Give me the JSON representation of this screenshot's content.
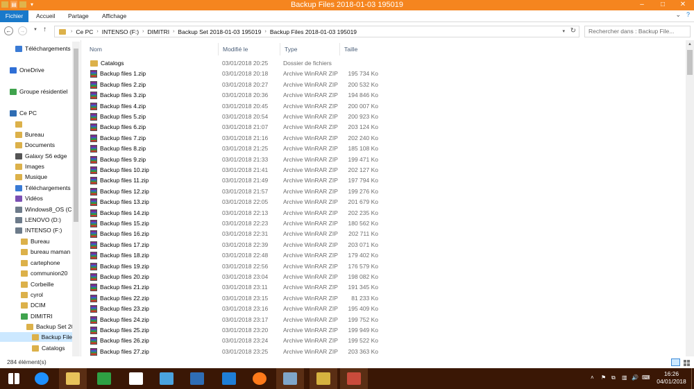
{
  "window": {
    "title": "Backup Files 2018-01-03 195019",
    "controls": {
      "minimize": "–",
      "maximize": "□",
      "close": "✕"
    }
  },
  "ribbon": {
    "tabs": [
      "Fichier",
      "Accueil",
      "Partage",
      "Affichage"
    ],
    "expand": "⌄",
    "help": "?"
  },
  "address": {
    "segments": [
      "Ce PC",
      "INTENSO (F:)",
      "DIMITRI",
      "Backup Set 2018-01-03 195019",
      "Backup Files 2018-01-03 195019"
    ],
    "search_placeholder": "Rechercher dans : Backup File..."
  },
  "navpane": [
    {
      "label": "Téléchargements",
      "kind": "download",
      "indent": 1
    },
    {
      "label": "OneDrive",
      "kind": "cloud",
      "indent": 0
    },
    {
      "label": "Groupe résidentiel",
      "kind": "group",
      "indent": 0
    },
    {
      "label": "Ce PC",
      "kind": "pc",
      "indent": 0
    },
    {
      "label": "",
      "kind": "folder",
      "indent": 1
    },
    {
      "label": "Bureau",
      "kind": "folder",
      "indent": 1
    },
    {
      "label": "Documents",
      "kind": "folder",
      "indent": 1
    },
    {
      "label": "Galaxy S6 edge",
      "kind": "phone",
      "indent": 1
    },
    {
      "label": "Images",
      "kind": "folder",
      "indent": 1
    },
    {
      "label": "Musique",
      "kind": "music",
      "indent": 1
    },
    {
      "label": "Téléchargements",
      "kind": "download",
      "indent": 1
    },
    {
      "label": "Vidéos",
      "kind": "video",
      "indent": 1
    },
    {
      "label": "Windows8_OS (C",
      "kind": "drive",
      "indent": 1
    },
    {
      "label": "LENOVO (D:)",
      "kind": "drive",
      "indent": 1
    },
    {
      "label": "INTENSO (F:)",
      "kind": "drive",
      "indent": 1
    },
    {
      "label": "Bureau",
      "kind": "folder",
      "indent": 2
    },
    {
      "label": "bureau maman",
      "kind": "folder",
      "indent": 2
    },
    {
      "label": "cartephone",
      "kind": "folder",
      "indent": 2
    },
    {
      "label": "communion20",
      "kind": "folder",
      "indent": 2
    },
    {
      "label": "Corbeille",
      "kind": "folder",
      "indent": 2
    },
    {
      "label": "cyrol",
      "kind": "folder",
      "indent": 2
    },
    {
      "label": "DCIM",
      "kind": "folder",
      "indent": 2
    },
    {
      "label": "DIMITRI",
      "kind": "user",
      "indent": 2
    },
    {
      "label": "Backup Set 20",
      "kind": "folder",
      "indent": 3
    },
    {
      "label": "Backup File",
      "kind": "folder",
      "indent": 4,
      "selected": true
    },
    {
      "label": "Catalogs",
      "kind": "folder",
      "indent": 4
    }
  ],
  "columns": [
    "Nom",
    "Modifié le",
    "Type",
    "Taille"
  ],
  "files": [
    {
      "name": "Catalogs",
      "date": "03/01/2018 20:25",
      "type": "Dossier de fichiers",
      "size": "",
      "kind": "folder"
    },
    {
      "name": "Backup files 1.zip",
      "date": "03/01/2018 20:18",
      "type": "Archive WinRAR ZIP",
      "size": "195 734 Ko",
      "kind": "zip"
    },
    {
      "name": "Backup files 2.zip",
      "date": "03/01/2018 20:27",
      "type": "Archive WinRAR ZIP",
      "size": "200 532 Ko",
      "kind": "zip"
    },
    {
      "name": "Backup files 3.zip",
      "date": "03/01/2018 20:36",
      "type": "Archive WinRAR ZIP",
      "size": "194 846 Ko",
      "kind": "zip"
    },
    {
      "name": "Backup files 4.zip",
      "date": "03/01/2018 20:45",
      "type": "Archive WinRAR ZIP",
      "size": "200 007 Ko",
      "kind": "zip"
    },
    {
      "name": "Backup files 5.zip",
      "date": "03/01/2018 20:54",
      "type": "Archive WinRAR ZIP",
      "size": "200 923 Ko",
      "kind": "zip"
    },
    {
      "name": "Backup files 6.zip",
      "date": "03/01/2018 21:07",
      "type": "Archive WinRAR ZIP",
      "size": "203 124 Ko",
      "kind": "zip"
    },
    {
      "name": "Backup files 7.zip",
      "date": "03/01/2018 21:16",
      "type": "Archive WinRAR ZIP",
      "size": "202 240 Ko",
      "kind": "zip"
    },
    {
      "name": "Backup files 8.zip",
      "date": "03/01/2018 21:25",
      "type": "Archive WinRAR ZIP",
      "size": "185 108 Ko",
      "kind": "zip"
    },
    {
      "name": "Backup files 9.zip",
      "date": "03/01/2018 21:33",
      "type": "Archive WinRAR ZIP",
      "size": "199 471 Ko",
      "kind": "zip"
    },
    {
      "name": "Backup files 10.zip",
      "date": "03/01/2018 21:41",
      "type": "Archive WinRAR ZIP",
      "size": "202 127 Ko",
      "kind": "zip"
    },
    {
      "name": "Backup files 11.zip",
      "date": "03/01/2018 21:49",
      "type": "Archive WinRAR ZIP",
      "size": "197 794 Ko",
      "kind": "zip"
    },
    {
      "name": "Backup files 12.zip",
      "date": "03/01/2018 21:57",
      "type": "Archive WinRAR ZIP",
      "size": "199 276 Ko",
      "kind": "zip"
    },
    {
      "name": "Backup files 13.zip",
      "date": "03/01/2018 22:05",
      "type": "Archive WinRAR ZIP",
      "size": "201 679 Ko",
      "kind": "zip"
    },
    {
      "name": "Backup files 14.zip",
      "date": "03/01/2018 22:13",
      "type": "Archive WinRAR ZIP",
      "size": "202 235 Ko",
      "kind": "zip"
    },
    {
      "name": "Backup files 15.zip",
      "date": "03/01/2018 22:23",
      "type": "Archive WinRAR ZIP",
      "size": "180 562 Ko",
      "kind": "zip"
    },
    {
      "name": "Backup files 16.zip",
      "date": "03/01/2018 22:31",
      "type": "Archive WinRAR ZIP",
      "size": "202 711 Ko",
      "kind": "zip"
    },
    {
      "name": "Backup files 17.zip",
      "date": "03/01/2018 22:39",
      "type": "Archive WinRAR ZIP",
      "size": "203 071 Ko",
      "kind": "zip"
    },
    {
      "name": "Backup files 18.zip",
      "date": "03/01/2018 22:48",
      "type": "Archive WinRAR ZIP",
      "size": "179 402 Ko",
      "kind": "zip"
    },
    {
      "name": "Backup files 19.zip",
      "date": "03/01/2018 22:56",
      "type": "Archive WinRAR ZIP",
      "size": "176 579 Ko",
      "kind": "zip"
    },
    {
      "name": "Backup files 20.zip",
      "date": "03/01/2018 23:04",
      "type": "Archive WinRAR ZIP",
      "size": "198 082 Ko",
      "kind": "zip"
    },
    {
      "name": "Backup files 21.zip",
      "date": "03/01/2018 23:11",
      "type": "Archive WinRAR ZIP",
      "size": "191 345 Ko",
      "kind": "zip"
    },
    {
      "name": "Backup files 22.zip",
      "date": "03/01/2018 23:15",
      "type": "Archive WinRAR ZIP",
      "size": "81 233 Ko",
      "kind": "zip"
    },
    {
      "name": "Backup files 23.zip",
      "date": "03/01/2018 23:16",
      "type": "Archive WinRAR ZIP",
      "size": "195 409 Ko",
      "kind": "zip"
    },
    {
      "name": "Backup files 24.zip",
      "date": "03/01/2018 23:17",
      "type": "Archive WinRAR ZIP",
      "size": "199 752 Ko",
      "kind": "zip"
    },
    {
      "name": "Backup files 25.zip",
      "date": "03/01/2018 23:20",
      "type": "Archive WinRAR ZIP",
      "size": "199 949 Ko",
      "kind": "zip"
    },
    {
      "name": "Backup files 26.zip",
      "date": "03/01/2018 23:24",
      "type": "Archive WinRAR ZIP",
      "size": "199 522 Ko",
      "kind": "zip"
    },
    {
      "name": "Backup files 27.zip",
      "date": "03/01/2018 23:25",
      "type": "Archive WinRAR ZIP",
      "size": "203 363 Ko",
      "kind": "zip"
    }
  ],
  "status": {
    "count": "284 élément(s)"
  },
  "taskbar": {
    "apps": [
      {
        "icon": "windows-start-icon",
        "color": "#ffffff"
      },
      {
        "icon": "internet-explorer-icon",
        "color": "#1e90ff"
      },
      {
        "icon": "file-explorer-icon",
        "color": "#e8c35a"
      },
      {
        "icon": "store-icon",
        "color": "#2ea043"
      },
      {
        "icon": "home-icon",
        "color": "#ffffff"
      },
      {
        "icon": "mail-icon",
        "color": "#4aa3df"
      },
      {
        "icon": "computer-icon",
        "color": "#2f6db4"
      },
      {
        "icon": "app-icon",
        "color": "#1f7ed6"
      },
      {
        "icon": "firefox-icon",
        "color": "#ff7a1a"
      },
      {
        "icon": "control-panel-icon",
        "color": "#7fa6c9"
      },
      {
        "icon": "download-folder-icon",
        "color": "#d6b23f"
      },
      {
        "icon": "usb-icon",
        "color": "#c94b3b"
      }
    ],
    "tray": [
      "˄",
      "⚑",
      "⧉",
      "▥",
      "🔊",
      "⌨"
    ],
    "time": "16:26",
    "date": "04/01/2018"
  }
}
